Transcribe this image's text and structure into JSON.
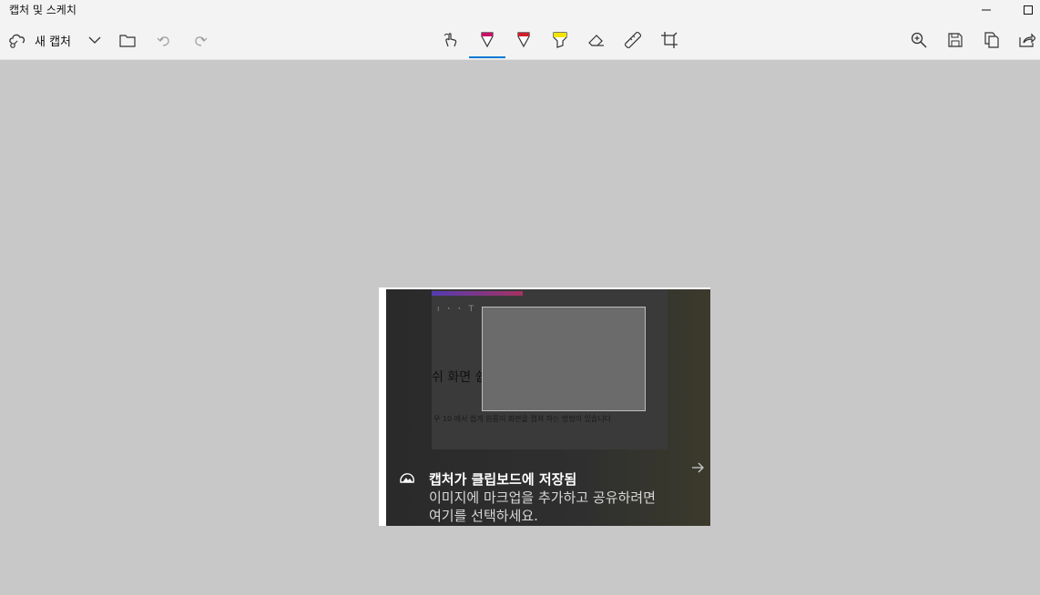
{
  "window": {
    "title": "캡처 및 스케치",
    "minimize_icon": "minimize-icon",
    "maximize_icon": "maximize-icon"
  },
  "toolbar": {
    "new_capture_label": "새 캡처",
    "icons": [
      "new-capture-icon",
      "chevron-down-icon",
      "folder-icon",
      "undo-icon",
      "redo-icon",
      "touch-writing-icon",
      "ballpoint-pen-icon",
      "pencil-icon",
      "highlighter-icon",
      "eraser-icon",
      "ruler-icon",
      "crop-icon",
      "zoom-in-icon",
      "save-icon",
      "copy-icon",
      "share-icon"
    ],
    "active_tool": "ballpoint-pen",
    "colors": {
      "pen_magenta": "#c8106a",
      "pencil_red": "#d0202a",
      "highlighter_yellow": "#f2e400",
      "accent": "#0078d4"
    }
  },
  "capture": {
    "background_heading": "쉬 화면 쉽게 캡쳐'하기! 화면 캡쳐 꿀팁",
    "background_sub": "우 10 에서 쉽게 원름이 화면을 캡쳐 하는 방법이 있습니다"
  },
  "toast": {
    "title": "캡처가 클립보드에 저장됨",
    "line1": "이미지에 마크업을 추가하고 공유하려면",
    "line2": "여기를 선택하세요."
  }
}
